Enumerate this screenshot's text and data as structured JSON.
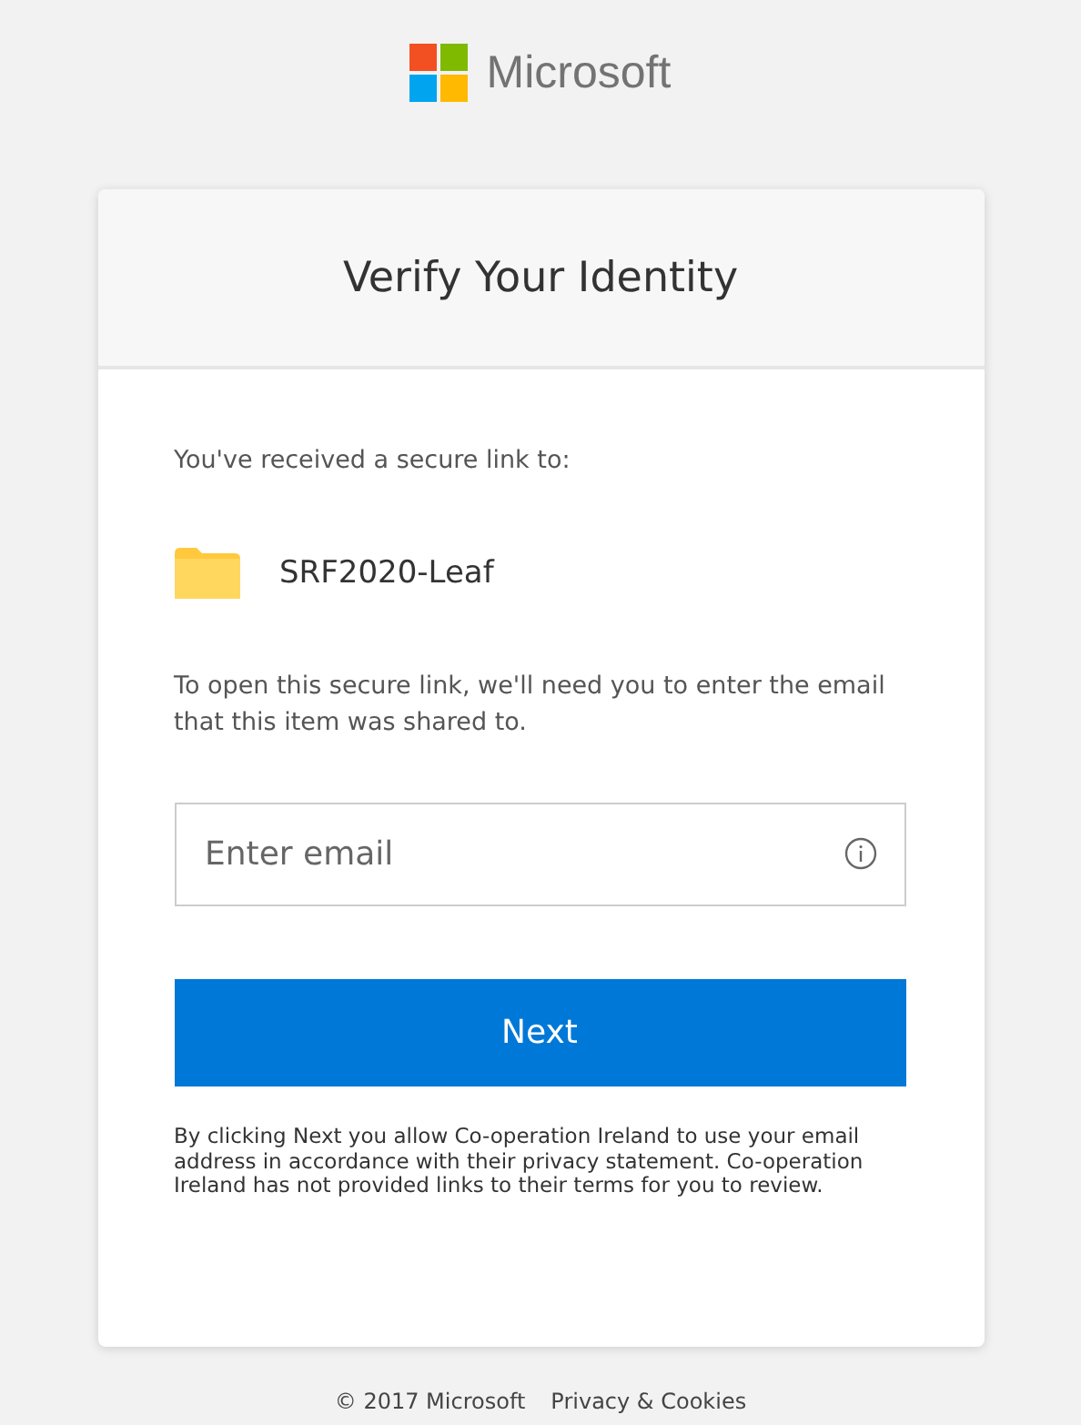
{
  "brand": {
    "name": "Microsoft"
  },
  "card": {
    "title": "Verify Your Identity",
    "intro": "You've received a secure link to:",
    "item": {
      "kind": "folder",
      "name": "SRF2020-Leaf"
    },
    "instructions": "To open this secure link, we'll need you to enter the email that this item was shared to.",
    "email_field": {
      "placeholder": "Enter email"
    },
    "button": "Next",
    "disclaimer": "By clicking Next you allow Co-operation Ireland to use your email address in accordance with their privacy statement. Co-operation Ireland has not provided links to their terms for you to review."
  },
  "footer": {
    "copyright": "© 2017 Microsoft",
    "link": "Privacy & Cookies"
  }
}
